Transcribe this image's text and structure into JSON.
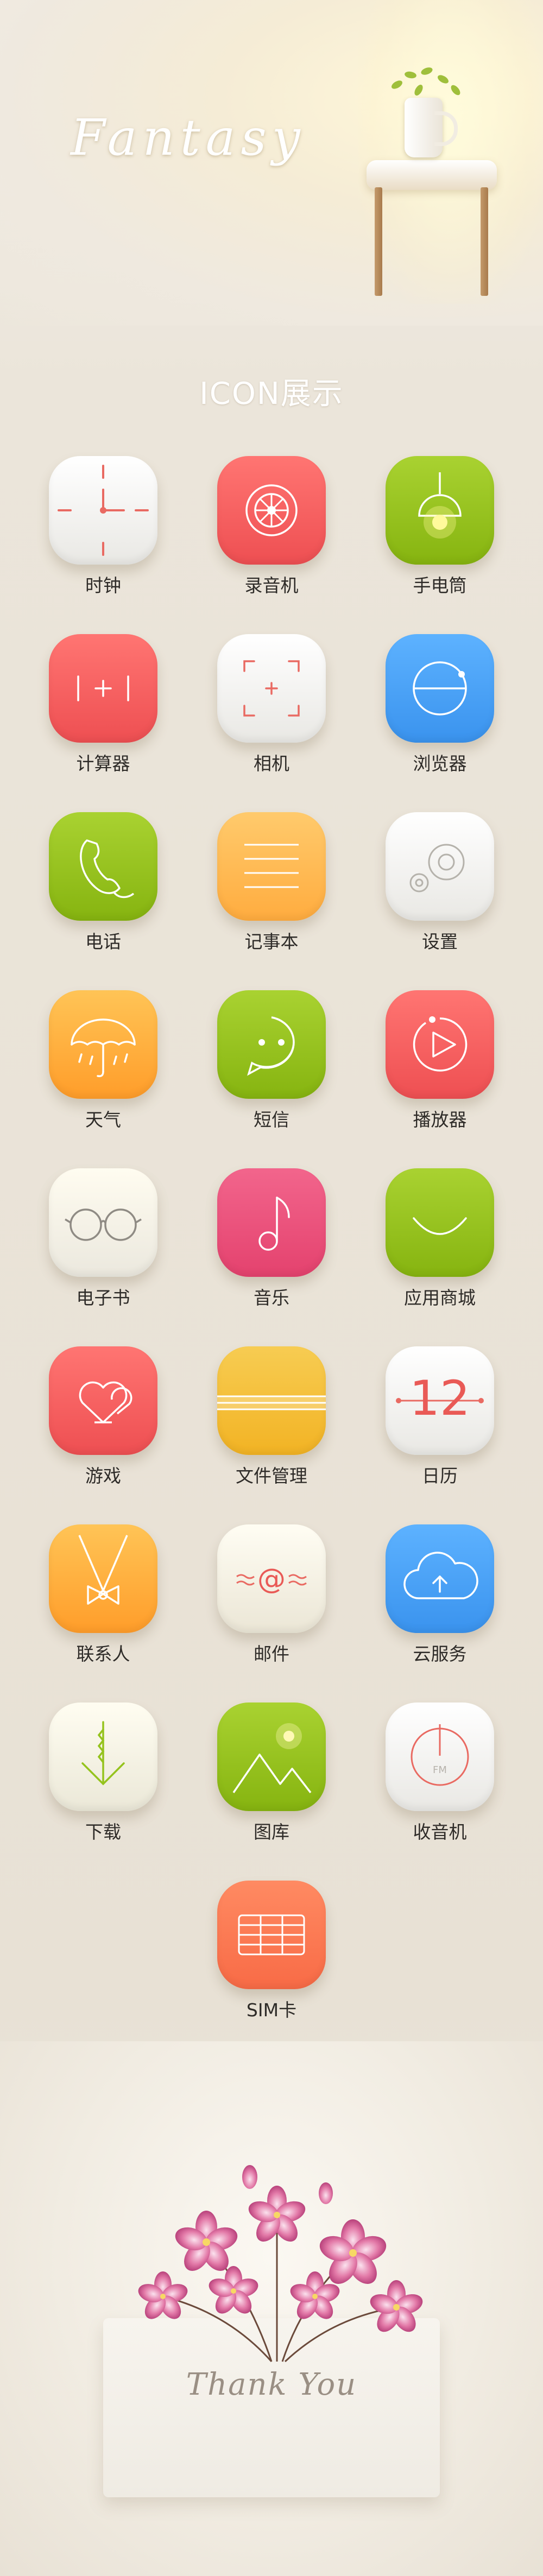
{
  "header": {
    "title": "Fantasy"
  },
  "section": {
    "title": "ICON展示"
  },
  "icons": [
    {
      "label": "时钟",
      "icon": "clock-icon",
      "color": "#f4f4f2"
    },
    {
      "label": "录音机",
      "icon": "recorder-icon",
      "color": "#f05c5a"
    },
    {
      "label": "手电筒",
      "icon": "flashlight-icon",
      "color": "#95c31d"
    },
    {
      "label": "计算器",
      "icon": "calculator-icon",
      "color": "#f05c5a"
    },
    {
      "label": "相机",
      "icon": "camera-icon",
      "color": "#f6f5f2"
    },
    {
      "label": "浏览器",
      "icon": "browser-icon",
      "color": "#3f9ef3"
    },
    {
      "label": "电话",
      "icon": "phone-icon",
      "color": "#95c31d"
    },
    {
      "label": "记事本",
      "icon": "notepad-icon",
      "color": "#ffbd57"
    },
    {
      "label": "设置",
      "icon": "settings-icon",
      "color": "#f3f3f1"
    },
    {
      "label": "天气",
      "icon": "weather-icon",
      "color": "#ffb23f"
    },
    {
      "label": "短信",
      "icon": "message-icon",
      "color": "#95c31d"
    },
    {
      "label": "播放器",
      "icon": "player-icon",
      "color": "#f05c5a"
    },
    {
      "label": "电子书",
      "icon": "ebook-icon",
      "color": "#f6f5ef"
    },
    {
      "label": "音乐",
      "icon": "music-icon",
      "color": "#ea4f7a"
    },
    {
      "label": "应用商城",
      "icon": "app-store-icon",
      "color": "#95c31d"
    },
    {
      "label": "游戏",
      "icon": "game-icon",
      "color": "#f05c5a"
    },
    {
      "label": "文件管理",
      "icon": "file-manager-icon",
      "color": "#f5c13a"
    },
    {
      "label": "日历",
      "icon": "calendar-icon",
      "color": "#f6f5f2"
    },
    {
      "label": "联系人",
      "icon": "contacts-icon",
      "color": "#ffb23f"
    },
    {
      "label": "邮件",
      "icon": "mail-icon",
      "color": "#f7f3e6"
    },
    {
      "label": "云服务",
      "icon": "cloud-icon",
      "color": "#3f9ef3"
    },
    {
      "label": "下载",
      "icon": "download-icon",
      "color": "#f7f5e6"
    },
    {
      "label": "图库",
      "icon": "gallery-icon",
      "color": "#95c31d"
    },
    {
      "label": "收音机",
      "icon": "radio-icon",
      "color": "#f6f5f2"
    },
    {
      "label": "SIM卡",
      "icon": "sim-card-icon",
      "color": "#f8744f"
    }
  ],
  "icon_text": {
    "calendar_day": "12",
    "mail_symbol": "@",
    "radio_band": "FM"
  },
  "footer": {
    "text": "Thank You"
  }
}
